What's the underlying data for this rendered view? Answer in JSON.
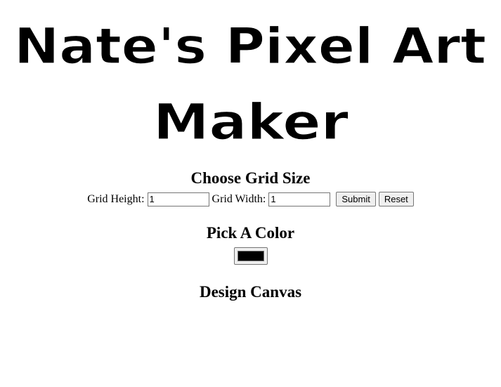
{
  "title": {
    "line1": "Nate's Pixel Art",
    "line2": "Maker"
  },
  "grid_section": {
    "heading": "Choose Grid Size",
    "height_label": "Grid Height:",
    "height_value": "1",
    "width_label": "Grid Width:",
    "width_value": "1",
    "submit_label": "Submit",
    "reset_label": "Reset"
  },
  "color_section": {
    "heading": "Pick A Color",
    "current_color": "#000000"
  },
  "canvas_section": {
    "heading": "Design Canvas"
  }
}
